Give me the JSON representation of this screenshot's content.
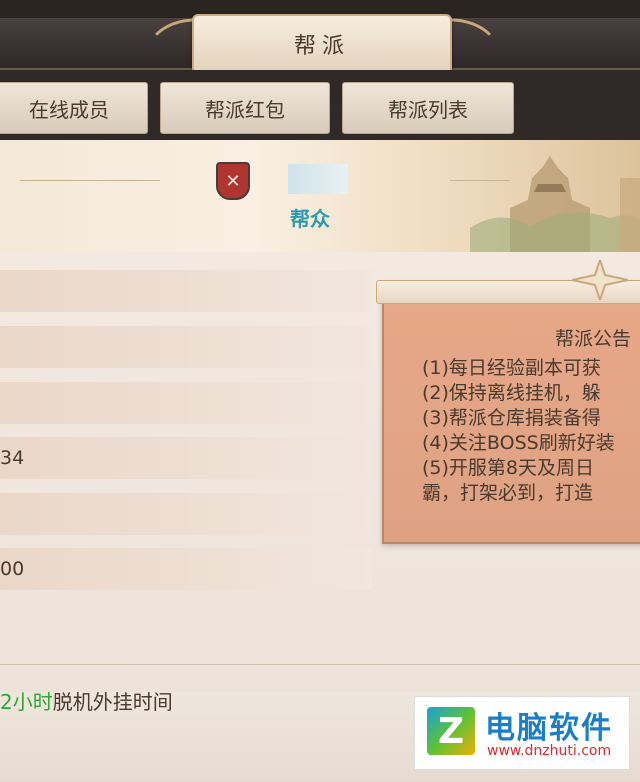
{
  "window": {
    "title": "帮派"
  },
  "tabs": [
    {
      "label": "在线成员"
    },
    {
      "label": "帮派红包"
    },
    {
      "label": "帮派列表"
    }
  ],
  "guild": {
    "emblem_symbol": "✕",
    "rank": "帮众"
  },
  "info_rows": [
    {
      "value": ""
    },
    {
      "value": ""
    },
    {
      "value": ""
    },
    {
      "value": "34"
    },
    {
      "value": ""
    },
    {
      "value": "00"
    }
  ],
  "notice": {
    "title": "帮派公告",
    "lines": [
      "(1)每日经验副本可获",
      "(2)保持离线挂机，躲",
      "(3)帮派仓库捐装备得",
      "(4)关注BOSS刷新好装",
      "(5)开服第8天及周日",
      "霸，打架必到，打造"
    ]
  },
  "bottom": {
    "highlight": "2小时",
    "text": "脱机外挂时间"
  },
  "watermark": {
    "logo_letter": "Z",
    "name": "电脑软件",
    "url": "www.dnzhuti.com"
  },
  "colors": {
    "accent_green": "#2fa73c",
    "rank_blue": "#2c9bb0",
    "emblem_red": "#b03530"
  }
}
